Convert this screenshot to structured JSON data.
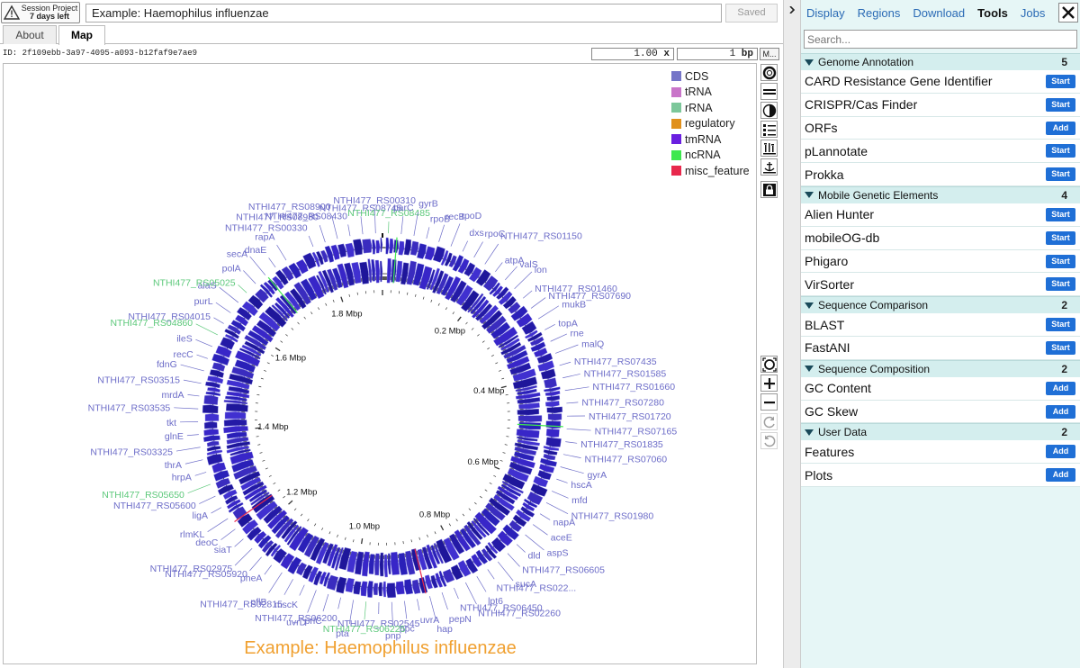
{
  "session": {
    "line1": "Session Project",
    "line2": "7 days left"
  },
  "map_title_input": "Example: Haemophilus influenzae",
  "saved_label": "Saved",
  "tabs": [
    {
      "label": "About"
    },
    {
      "label": "Map"
    }
  ],
  "id_row": {
    "id": "ID:  2f109ebb-3a97-4095-a093-b12faf9e7ae9"
  },
  "zoom": {
    "value": "1.00",
    "unit": "x"
  },
  "bp": {
    "value": "1",
    "unit": "bp"
  },
  "more_btn": "M...",
  "map": {
    "caption": "Example: Haemophilus influenzae",
    "legend": [
      {
        "label": "CDS",
        "color": "#7575c8"
      },
      {
        "label": "tRNA",
        "color": "#c975c9"
      },
      {
        "label": "rRNA",
        "color": "#7cc79a"
      },
      {
        "label": "regulatory",
        "color": "#e0901c"
      },
      {
        "label": "tmRNA",
        "color": "#6a1fe0"
      },
      {
        "label": "ncRNA",
        "color": "#3ee84e"
      },
      {
        "label": "misc_feature",
        "color": "#e8284c"
      }
    ],
    "ruler_labels": [
      "1.8 Mbp",
      "0.2 Mbp",
      "1.6 Mbp",
      "0.4 Mbp",
      "1.4 Mbp",
      "0.6 Mbp",
      "1.2 Mbp",
      "0.8 Mbp",
      "1.0 Mbp"
    ],
    "feature_labels": [
      {
        "t": "NTHI477_RS00330",
        "g": false
      },
      {
        "t": "NTHI477_RS08980",
        "g": false
      },
      {
        "t": "NTHI477_RS08900",
        "g": false
      },
      {
        "t": "NTHI477_RS08430",
        "g": false
      },
      {
        "t": "NTHI477_RS08745",
        "g": false
      },
      {
        "t": "NTHI477_RS00310",
        "g": false
      },
      {
        "t": "NTHI477_RS08485",
        "g": true
      },
      {
        "t": "parC",
        "g": false
      },
      {
        "t": "gyrB",
        "g": false
      },
      {
        "t": "rpoB",
        "g": false
      },
      {
        "t": "recB",
        "g": false
      },
      {
        "t": "rpoD",
        "g": false
      },
      {
        "t": "dxs",
        "g": false
      },
      {
        "t": "rpoC",
        "g": false
      },
      {
        "t": "NTHI477_RS01150",
        "g": false
      },
      {
        "t": "atpA",
        "g": false
      },
      {
        "t": "valS",
        "g": false
      },
      {
        "t": "lon",
        "g": false
      },
      {
        "t": "NTHI477_RS01460",
        "g": false
      },
      {
        "t": "NTHI477_RS07690",
        "g": false
      },
      {
        "t": "mukB",
        "g": false
      },
      {
        "t": "topA",
        "g": false
      },
      {
        "t": "rne",
        "g": false
      },
      {
        "t": "malQ",
        "g": false
      },
      {
        "t": "NTHI477_RS07435",
        "g": false
      },
      {
        "t": "NTHI477_RS01585",
        "g": false
      },
      {
        "t": "NTHI477_RS01660",
        "g": false
      },
      {
        "t": "NTHI477_RS07280",
        "g": false
      },
      {
        "t": "NTHI477_RS01720",
        "g": false
      },
      {
        "t": "NTHI477_RS07165",
        "g": false
      },
      {
        "t": "NTHI477_RS01835",
        "g": false
      },
      {
        "t": "NTHI477_RS07060",
        "g": false
      },
      {
        "t": "gyrA",
        "g": false
      },
      {
        "t": "hscA",
        "g": false
      },
      {
        "t": "mfd",
        "g": false
      },
      {
        "t": "NTHI477_RS01980",
        "g": false
      },
      {
        "t": "napA",
        "g": false
      },
      {
        "t": "aceE",
        "g": false
      },
      {
        "t": "aspS",
        "g": false
      },
      {
        "t": "dld",
        "g": false
      },
      {
        "t": "NTHI477_RS06605",
        "g": false
      },
      {
        "t": "sucA",
        "g": false
      },
      {
        "t": "NTHI477_RS022...",
        "g": false
      },
      {
        "t": "lpt6",
        "g": false
      },
      {
        "t": "NTHI477_RS02260",
        "g": false
      },
      {
        "t": "NTHI477_RS06450",
        "g": false
      },
      {
        "t": "pepN",
        "g": false
      },
      {
        "t": "hap",
        "g": false
      },
      {
        "t": "uvrA",
        "g": false
      },
      {
        "t": "ppc",
        "g": false
      },
      {
        "t": "pnp",
        "g": false
      },
      {
        "t": "NTHI477_RS02545",
        "g": false
      },
      {
        "t": "NTHI477_RS06225",
        "g": true
      },
      {
        "t": "pta",
        "g": false
      },
      {
        "t": "NTHI477_RS06200",
        "g": false
      },
      {
        "t": "prlC",
        "g": false
      },
      {
        "t": "uvrD",
        "g": false
      },
      {
        "t": "mscK",
        "g": false
      },
      {
        "t": "NTHI477_RS02815",
        "g": false
      },
      {
        "t": "pflB",
        "g": false
      },
      {
        "t": "pheA",
        "g": false
      },
      {
        "t": "NTHI477_RS05920",
        "g": false
      },
      {
        "t": "NTHI477_RS02975",
        "g": false
      },
      {
        "t": "siaT",
        "g": false
      },
      {
        "t": "deoC",
        "g": false
      },
      {
        "t": "rlmKL",
        "g": false
      },
      {
        "t": "ligA",
        "g": false
      },
      {
        "t": "NTHI477_RS05600",
        "g": false
      },
      {
        "t": "NTHI477_RS05650",
        "g": true
      },
      {
        "t": "hrpA",
        "g": false
      },
      {
        "t": "thrA",
        "g": false
      },
      {
        "t": "NTHI477_RS03325",
        "g": false
      },
      {
        "t": "glnE",
        "g": false
      },
      {
        "t": "tkt",
        "g": false
      },
      {
        "t": "NTHI477_RS03535",
        "g": false
      },
      {
        "t": "mrdA",
        "g": false
      },
      {
        "t": "NTHI477_RS03515",
        "g": false
      },
      {
        "t": "fdnG",
        "g": false
      },
      {
        "t": "recC",
        "g": false
      },
      {
        "t": "ileS",
        "g": false
      },
      {
        "t": "NTHI477_RS04860",
        "g": true
      },
      {
        "t": "NTHI477_RS04015",
        "g": false
      },
      {
        "t": "purL",
        "g": false
      },
      {
        "t": "alaS",
        "g": false
      },
      {
        "t": "NTHI477_RS05025",
        "g": true
      },
      {
        "t": "polA",
        "g": false
      },
      {
        "t": "secA",
        "g": false
      },
      {
        "t": "dnaE",
        "g": false
      },
      {
        "t": "rapA",
        "g": false
      }
    ]
  },
  "right": {
    "tabs": [
      {
        "label": "Display",
        "active": false
      },
      {
        "label": "Regions",
        "active": false
      },
      {
        "label": "Download",
        "active": false
      },
      {
        "label": "Tools",
        "active": true
      },
      {
        "label": "Jobs",
        "active": false
      }
    ],
    "search_placeholder": "Search...",
    "sections": [
      {
        "title": "Genome Annotation",
        "count": "5",
        "items": [
          {
            "label": "CARD Resistance Gene Identifier",
            "btn": "Start"
          },
          {
            "label": "CRISPR/Cas Finder",
            "btn": "Start"
          },
          {
            "label": "ORFs",
            "btn": "Add"
          },
          {
            "label": "pLannotate",
            "btn": "Start"
          },
          {
            "label": "Prokka",
            "btn": "Start"
          }
        ]
      },
      {
        "title": "Mobile Genetic Elements",
        "count": "4",
        "items": [
          {
            "label": "Alien Hunter",
            "btn": "Start"
          },
          {
            "label": "mobileOG-db",
            "btn": "Start"
          },
          {
            "label": "Phigaro",
            "btn": "Start"
          },
          {
            "label": "VirSorter",
            "btn": "Start"
          }
        ]
      },
      {
        "title": "Sequence Comparison",
        "count": "2",
        "items": [
          {
            "label": "BLAST",
            "btn": "Start"
          },
          {
            "label": "FastANI",
            "btn": "Start"
          }
        ]
      },
      {
        "title": "Sequence Composition",
        "count": "2",
        "items": [
          {
            "label": "GC Content",
            "btn": "Add"
          },
          {
            "label": "GC Skew",
            "btn": "Add"
          }
        ]
      },
      {
        "title": "User Data",
        "count": "2",
        "items": [
          {
            "label": "Features",
            "btn": "Add"
          },
          {
            "label": "Plots",
            "btn": "Add"
          }
        ]
      }
    ]
  }
}
